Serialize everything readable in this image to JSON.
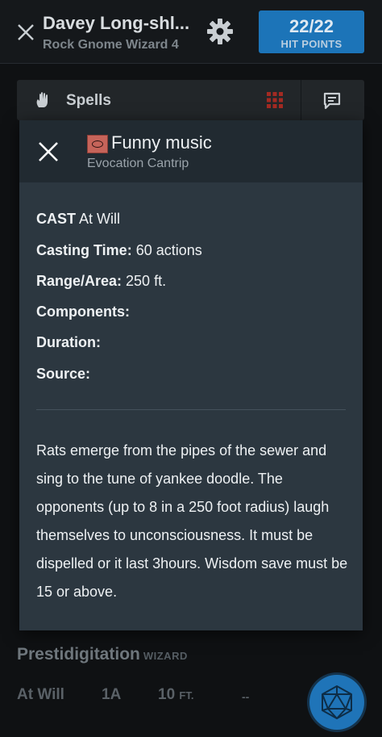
{
  "header": {
    "close_icon": "close-icon",
    "character_name": "Davey Long-shl...",
    "character_subtitle": "Rock Gnome Wizard 4",
    "settings_icon": "gear-icon",
    "hit_points_value": "22/22",
    "hit_points_label": "HIT POINTS"
  },
  "tabbar": {
    "label": "Spells",
    "icons": [
      "hand-icon",
      "grid-icon",
      "chat-icon"
    ]
  },
  "dialog": {
    "close_icon": "close-icon",
    "spell_name": "Funny music",
    "spell_type": "Evocation Cantrip",
    "cast_label": "CAST",
    "cast_value": " At Will",
    "casting_time_label": "Casting Time:",
    "casting_time_value": " 60 actions",
    "range_label": "Range/Area:",
    "range_value": " 250 ft.",
    "components_label": "Components:",
    "duration_label": "Duration:",
    "source_label": "Source:",
    "description": "Rats emerge from the pipes of the sewer and sing to the tune of yankee doodle. The opponents (up to 8 in a 250 foot radius) laugh themselves to unconsciousness. It must be dispelled or it last 3hours. Wisdom save must be 15 or above."
  },
  "background_list": {
    "spell_title": "Prestidigitation",
    "spell_tag": "WIZARD",
    "row": {
      "casting": "At Will",
      "time": "1A",
      "range": "10",
      "range_unit": "FT.",
      "dash": "--"
    }
  },
  "colors": {
    "accent": "#1c74b8",
    "dialog_bg": "#2c3740",
    "dialog_header_bg": "#212a31"
  }
}
